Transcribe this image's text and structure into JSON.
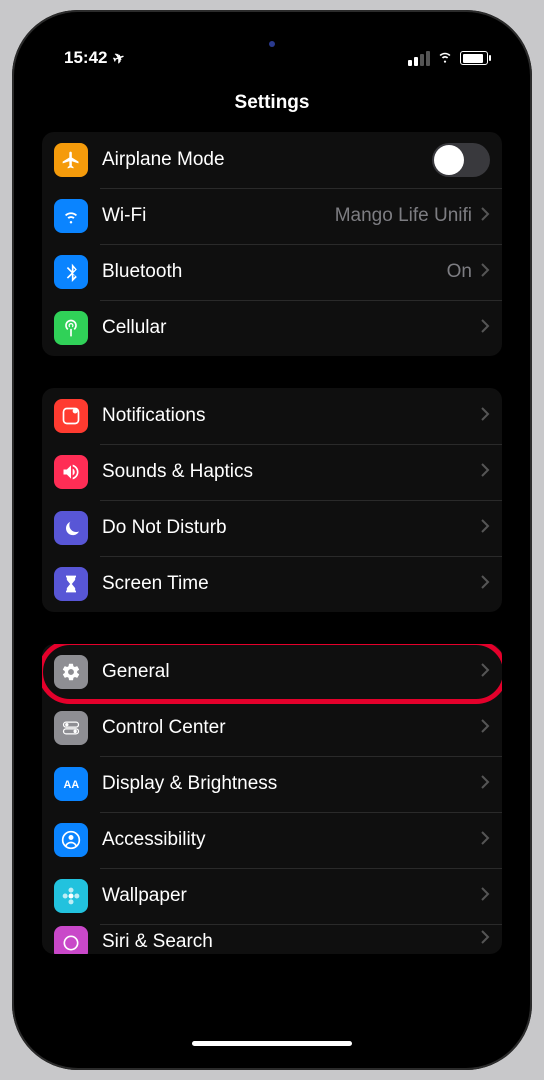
{
  "status": {
    "time": "15:42",
    "location_glyph": "➤"
  },
  "title": "Settings",
  "groups": [
    {
      "rows": [
        {
          "id": "airplane",
          "label": "Airplane Mode",
          "toggle": false,
          "icon_bg": "#f59b0b",
          "icon": "airplane"
        },
        {
          "id": "wifi",
          "label": "Wi-Fi",
          "value": "Mango Life Unifi",
          "nav": true,
          "icon_bg": "#0a84ff",
          "icon": "wifi"
        },
        {
          "id": "bluetooth",
          "label": "Bluetooth",
          "value": "On",
          "nav": true,
          "icon_bg": "#0a84ff",
          "icon": "bluetooth"
        },
        {
          "id": "cellular",
          "label": "Cellular",
          "nav": true,
          "icon_bg": "#30d158",
          "icon": "antenna"
        }
      ]
    },
    {
      "rows": [
        {
          "id": "notifications",
          "label": "Notifications",
          "nav": true,
          "icon_bg": "#ff3b30",
          "icon": "bell"
        },
        {
          "id": "sounds",
          "label": "Sounds & Haptics",
          "nav": true,
          "icon_bg": "#ff2d55",
          "icon": "speaker"
        },
        {
          "id": "dnd",
          "label": "Do Not Disturb",
          "nav": true,
          "icon_bg": "#5856d6",
          "icon": "moon"
        },
        {
          "id": "screentime",
          "label": "Screen Time",
          "nav": true,
          "icon_bg": "#5856d6",
          "icon": "hourglass"
        }
      ]
    },
    {
      "rows": [
        {
          "id": "general",
          "label": "General",
          "nav": true,
          "icon_bg": "#8e8e93",
          "icon": "gear",
          "highlight": true
        },
        {
          "id": "controlcenter",
          "label": "Control Center",
          "nav": true,
          "icon_bg": "#8e8e93",
          "icon": "switches"
        },
        {
          "id": "display",
          "label": "Display & Brightness",
          "nav": true,
          "icon_bg": "#0a84ff",
          "icon": "aa"
        },
        {
          "id": "accessibility",
          "label": "Accessibility",
          "nav": true,
          "icon_bg": "#0a84ff",
          "icon": "person"
        },
        {
          "id": "wallpaper",
          "label": "Wallpaper",
          "nav": true,
          "icon_bg": "#22c2de",
          "icon": "flower"
        },
        {
          "id": "siri",
          "label": "Siri & Search",
          "nav": true,
          "icon_bg": "#c948c9",
          "icon": "siri",
          "partial": true
        }
      ]
    }
  ]
}
